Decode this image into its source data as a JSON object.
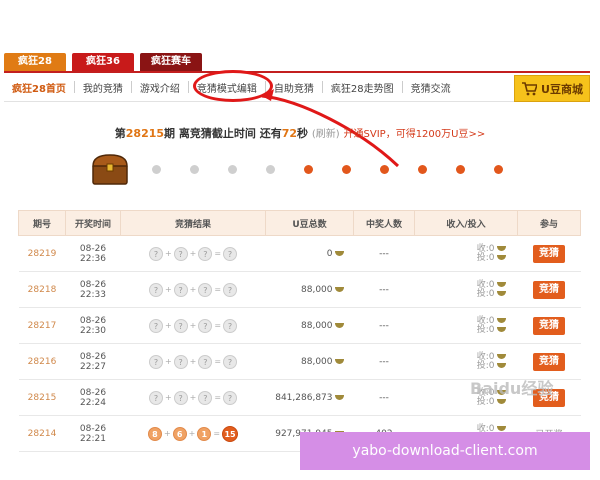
{
  "game_tabs": [
    "疯狂28",
    "疯狂36",
    "疯狂赛车"
  ],
  "nav": {
    "items": [
      "疯狂28首页",
      "我的竞猜",
      "游戏介绍",
      "竞猜模式编辑",
      "自助竞猜",
      "疯狂28走势图",
      "竞猜交流"
    ],
    "shop_label": "U豆商城"
  },
  "round": {
    "prefix": "第",
    "number": "28215",
    "mid": "期 离竞猜截止时间 还有",
    "countdown": "72",
    "unit": "秒",
    "paren": "(刷新)",
    "link": "开通SVIP，可得1200万U豆>>"
  },
  "table": {
    "headers": [
      "期号",
      "开奖时间",
      "竞猜结果",
      "U豆总数",
      "中奖人数",
      "收入/投入",
      "参与"
    ],
    "rows": [
      {
        "period": "28219",
        "date": "08-26",
        "time": "22:36",
        "balls": [
          "?",
          "?",
          "?",
          "?"
        ],
        "total": "0",
        "winners": "---",
        "income": "收:0",
        "invest": "投:0",
        "action": "竞猜"
      },
      {
        "period": "28218",
        "date": "08-26",
        "time": "22:33",
        "balls": [
          "?",
          "?",
          "?",
          "?"
        ],
        "total": "88,000",
        "winners": "---",
        "income": "收:0",
        "invest": "投:0",
        "action": "竞猜"
      },
      {
        "period": "28217",
        "date": "08-26",
        "time": "22:30",
        "balls": [
          "?",
          "?",
          "?",
          "?"
        ],
        "total": "88,000",
        "winners": "---",
        "income": "收:0",
        "invest": "投:0",
        "action": "竞猜"
      },
      {
        "period": "28216",
        "date": "08-26",
        "time": "22:27",
        "balls": [
          "?",
          "?",
          "?",
          "?"
        ],
        "total": "88,000",
        "winners": "---",
        "income": "收:0",
        "invest": "投:0",
        "action": "竞猜"
      },
      {
        "period": "28215",
        "date": "08-26",
        "time": "22:24",
        "balls": [
          "?",
          "?",
          "?",
          "?"
        ],
        "total": "841,286,873",
        "winners": "---",
        "income": "收:0",
        "invest": "投:0",
        "action": "竞猜"
      },
      {
        "period": "28214",
        "date": "08-26",
        "time": "22:21",
        "balls": [
          "8",
          "6",
          "1",
          "15"
        ],
        "total": "927,971,945",
        "winners": "402",
        "income": "收:0",
        "invest": "投:0",
        "action": "已开奖"
      }
    ]
  },
  "overlay_text": "yabo-download-client.com",
  "watermark": "Baidu经验"
}
